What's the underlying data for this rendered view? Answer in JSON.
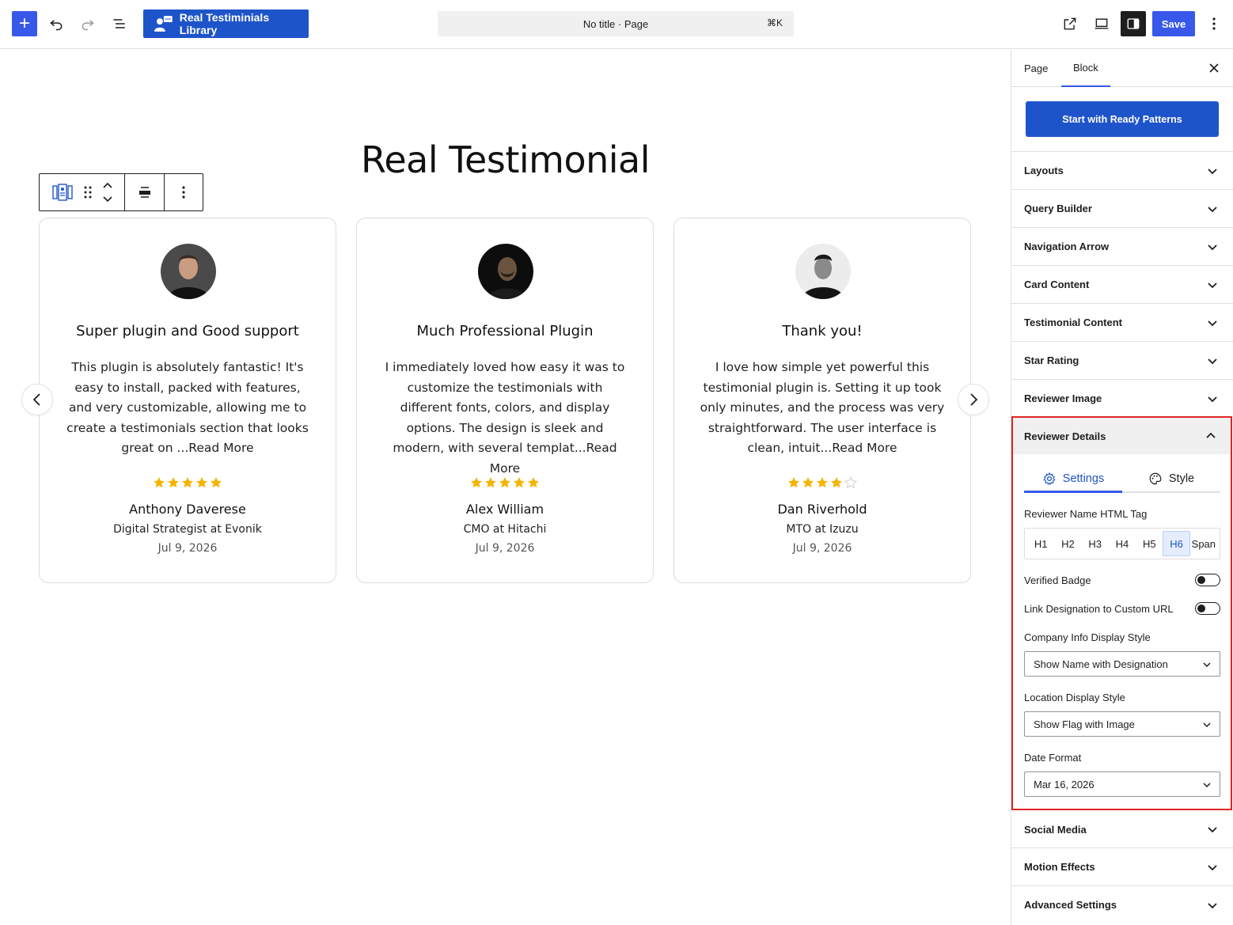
{
  "topbar": {
    "add_label": "+",
    "library_button": "Real Testiminials Library",
    "doc_title": "No title · Page",
    "shortcut": "⌘K",
    "save_label": "Save"
  },
  "canvas": {
    "heading": "Real Testimonial",
    "cards": [
      {
        "title": "Super plugin and Good support",
        "text": "This plugin is absolutely fantastic! It's easy to install, packed with features, and very customizable, allowing me to create a testimonials section that looks great on ...Read More",
        "rating": 5,
        "name": "Anthony Daverese",
        "role": "Digital Strategist at Evonik",
        "date": "Jul 9, 2026"
      },
      {
        "title": "Much Professional Plugin",
        "text": "I immediately loved how easy it was to customize the testimonials with different fonts, colors, and display options. The design is sleek and modern, with several templat...Read More",
        "rating": 5,
        "name": "Alex William",
        "role": "CMO at Hitachi",
        "date": "Jul 9, 2026"
      },
      {
        "title": "Thank you!",
        "text": "I love how simple yet powerful this testimonial plugin is. Setting it up took only minutes, and the process was very straightforward. The user interface is clean, intuit...Read More",
        "rating": 4,
        "name": "Dan Riverhold",
        "role": "MTO at Izuzu",
        "date": "Jul 9, 2026"
      }
    ],
    "star_color": "#f5b400",
    "star_empty_color": "#cfcfcf"
  },
  "sidebar": {
    "tabs": [
      "Page",
      "Block"
    ],
    "active_tab": "Block",
    "pattern_button": "Start with Ready Patterns",
    "panels_top": [
      "Layouts",
      "Query Builder",
      "Navigation Arrow",
      "Card Content",
      "Testimonial Content",
      "Star Rating",
      "Reviewer Image"
    ],
    "reviewer_details": {
      "title": "Reviewer Details",
      "tabs": [
        "Settings",
        "Style"
      ],
      "name_tag_label": "Reviewer Name HTML Tag",
      "name_tags": [
        "H1",
        "H2",
        "H3",
        "H4",
        "H5",
        "H6",
        "Span"
      ],
      "selected_tag": "H6",
      "verified_badge_label": "Verified Badge",
      "verified_badge_on": false,
      "link_designation_label": "Link Designation to Custom URL",
      "link_designation_on": false,
      "company_label": "Company Info Display Style",
      "company_value": "Show Name with Designation",
      "location_label": "Location Display Style",
      "location_value": "Show Flag with Image",
      "date_label": "Date Format",
      "date_value": "Mar 16, 2026"
    },
    "panels_bottom": [
      "Social Media",
      "Motion Effects",
      "Advanced Settings"
    ]
  },
  "colors": {
    "accent": "#3858e9",
    "library_blue": "#1e54c9",
    "highlight_red": "#e02424"
  }
}
